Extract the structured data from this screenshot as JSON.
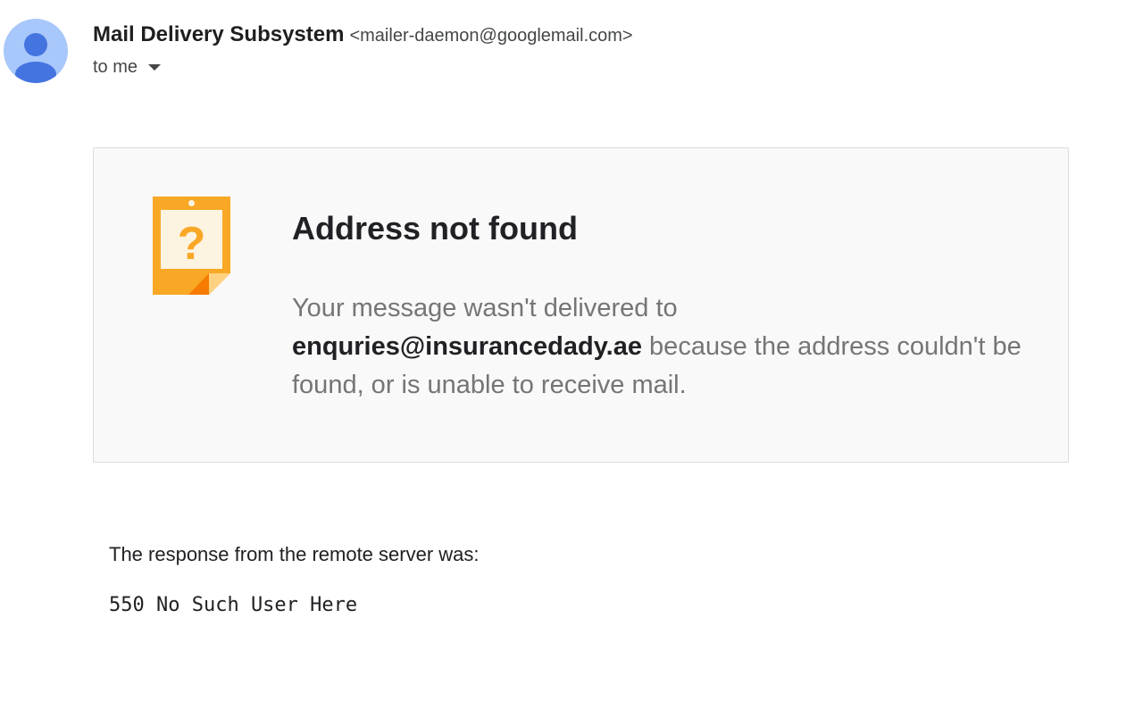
{
  "message": {
    "sender": {
      "name": "Mail Delivery Subsystem",
      "email": "<mailer-daemon@googlemail.com>",
      "avatar_color": "#a8c7fa",
      "avatar_figure_color": "#4374e0"
    },
    "recipient_label": "to me"
  },
  "bounce_card": {
    "icon": "question-note-icon",
    "icon_color": "#f9a825",
    "title": "Address not found",
    "message_before": "Your message wasn't delivered to ",
    "recipient_address": "enquries@insurancedady.ae",
    "message_after": " because the address couldn't be found, or is unable to receive mail."
  },
  "server_response": {
    "intro": "The response from the remote server was:",
    "code": "550 No Such User Here"
  }
}
